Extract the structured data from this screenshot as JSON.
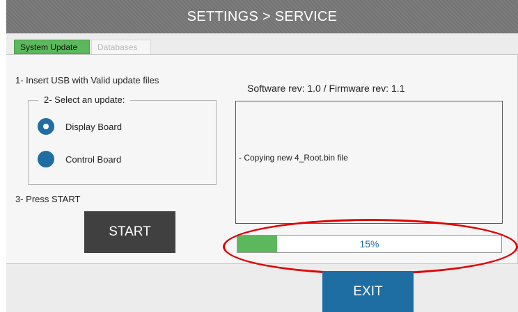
{
  "header": {
    "title": "SETTINGS > SERVICE"
  },
  "tabs": [
    {
      "label": "System Update",
      "active": true
    },
    {
      "label": "Databases",
      "active": false
    }
  ],
  "update_panel": {
    "step1": "1- Insert USB with Valid update files",
    "step2_legend": "2- Select an update:",
    "options": [
      {
        "label": "Display Board",
        "selected": true
      },
      {
        "label": "Control Board",
        "selected": false
      }
    ],
    "step3": "3- Press START",
    "start_label": "START"
  },
  "status": {
    "revision": "Software rev: 1.0  /  Firmware rev: 1.1",
    "log_text": "- Copying new 4_Root.bin file",
    "progress_percent": 15,
    "progress_label": "15%"
  },
  "footer": {
    "exit_label": "EXIT"
  },
  "colors": {
    "accent_blue": "#1f6ea3",
    "active_tab_green": "#5cb85c",
    "progress_green": "#5cb85c",
    "button_dark": "#404040",
    "highlight_red": "#e00000",
    "title_bar_gray": "#787878"
  },
  "icons": {
    "radio_selected": "radio-selected-icon",
    "radio_unselected": "radio-unselected-icon"
  }
}
